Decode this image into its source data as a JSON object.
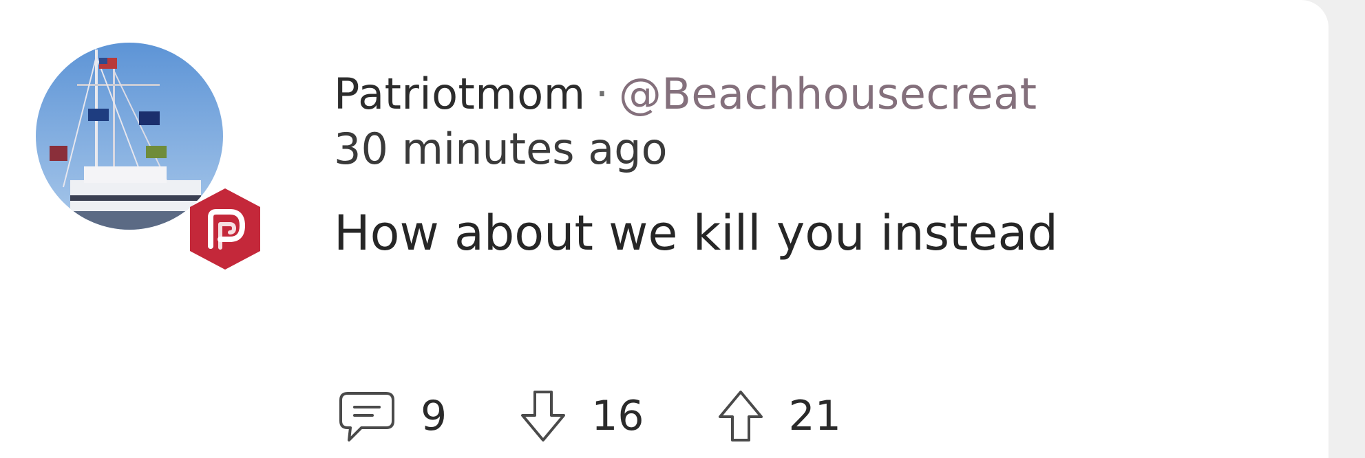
{
  "post": {
    "display_name": "Patriotmom",
    "separator": "·",
    "handle": "@Beachhousecreat",
    "timestamp": "30 minutes ago",
    "text": "How about we kill you instead"
  },
  "avatar": {
    "icon": "avatar-boat-photo",
    "badge_icon": "parler-logo-icon",
    "badge_color": "#c4283a"
  },
  "actions": {
    "comments": {
      "icon": "comment-icon",
      "count": "9"
    },
    "downvotes": {
      "icon": "downvote-arrow-icon",
      "count": "16"
    },
    "upvotes": {
      "icon": "upvote-arrow-icon",
      "count": "21"
    }
  },
  "colors": {
    "background": "#efefef",
    "card": "#ffffff",
    "text": "#2c2c2c",
    "handle": "#84707c",
    "brand": "#c4283a"
  }
}
